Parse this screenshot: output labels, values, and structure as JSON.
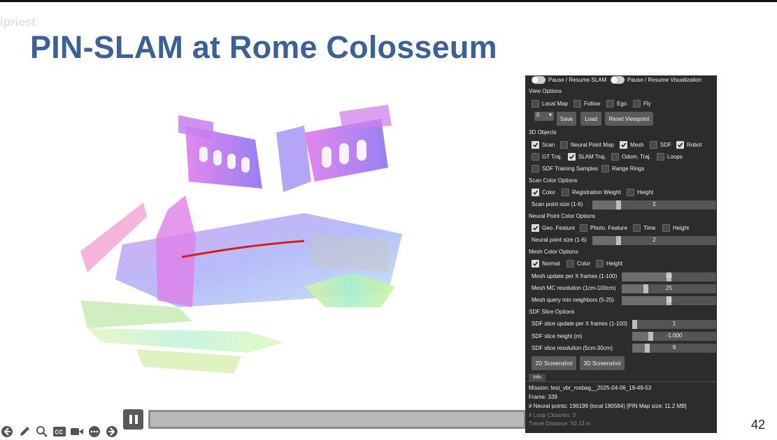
{
  "watermark": "ipriest",
  "slide": {
    "title": "PIN-SLAM at Rome Colosseum",
    "number": "42"
  },
  "panel": {
    "pause_slam": "Pause / Resume SLAM",
    "pause_vis": "Pause / Resume Visualization",
    "view_options": {
      "title": "View Options",
      "items": [
        {
          "label": "Local Map",
          "checked": false
        },
        {
          "label": "Follow",
          "checked": false
        },
        {
          "label": "Ego",
          "checked": false
        },
        {
          "label": "Fly",
          "checked": false
        }
      ],
      "viewpoint_index": "0",
      "save": "Save",
      "load": "Load",
      "reset": "Reset Viewpoint"
    },
    "objects": {
      "title": "3D Objects",
      "items": [
        {
          "label": "Scan",
          "checked": true
        },
        {
          "label": "Neural Point Map",
          "checked": false
        },
        {
          "label": "Mesh",
          "checked": true
        },
        {
          "label": "SDF",
          "checked": false
        },
        {
          "label": "Robot",
          "checked": true
        },
        {
          "label": "GT Traj.",
          "checked": false
        },
        {
          "label": "SLAM Traj.",
          "checked": true
        },
        {
          "label": "Odom. Traj.",
          "checked": false
        },
        {
          "label": "Loops",
          "checked": false
        },
        {
          "label": "SDF Training Samples",
          "checked": false
        },
        {
          "label": "Range Rings",
          "checked": false
        }
      ]
    },
    "scan_color": {
      "title": "Scan Color Options",
      "items": [
        {
          "label": "Color",
          "checked": true
        },
        {
          "label": "Registration Weight",
          "checked": false
        },
        {
          "label": "Height",
          "checked": false
        }
      ],
      "size_label": "Scan point size (1-6)",
      "size_value": "2",
      "size_fraction": 0.2
    },
    "neural_color": {
      "title": "Neural Point Color Options",
      "items": [
        {
          "label": "Geo. Feature",
          "checked": true
        },
        {
          "label": "Photo. Feature",
          "checked": false
        },
        {
          "label": "Time",
          "checked": false
        },
        {
          "label": "Height",
          "checked": false
        }
      ],
      "size_label": "Neural point size (1-6)",
      "size_value": "2",
      "size_fraction": 0.2
    },
    "mesh_color": {
      "title": "Mesh Color Options",
      "items": [
        {
          "label": "Normal",
          "checked": true
        },
        {
          "label": "Color",
          "checked": false
        },
        {
          "label": "Height",
          "checked": false
        }
      ],
      "sliders": [
        {
          "label": "Mesh update per X frames (1-100)",
          "value": "50",
          "fraction": 0.5
        },
        {
          "label": "Mesh MC resolution (1cm-100cm)",
          "value": "25",
          "fraction": 0.24
        },
        {
          "label": "Mesh query min neighbors (5-25)",
          "value": "15",
          "fraction": 0.5
        }
      ]
    },
    "sdf_slice": {
      "title": "SDF Slice Options",
      "sliders": [
        {
          "label": "SDF slice update per X frames (1-100)",
          "value": "1",
          "fraction": 0.0
        },
        {
          "label": "SDF slice height (m)",
          "value": "-1.000",
          "fraction": 0.2
        },
        {
          "label": "SDF slice resolution (5cm-30cm)",
          "value": "9",
          "fraction": 0.16
        }
      ]
    },
    "screenshot_2d": "2D Screenshot",
    "screenshot_3d": "3D Screenshot",
    "info": {
      "tab": "Info",
      "mission": "Mission: test_vbr_rosbag__2025-04-06_19-49-53",
      "frame": "Frame: 339",
      "neural_points": "# Neural points: 196199 (local 180584) [PIN Map size: 11.2 MB]",
      "loop_closures": "# Loop Closures: 0",
      "travel_distance": "Travel Distance: 50.13 m"
    }
  },
  "player": {
    "progress": 0.72
  },
  "colors": {
    "title": "#3c6196",
    "panel": "#2c2c2c"
  }
}
